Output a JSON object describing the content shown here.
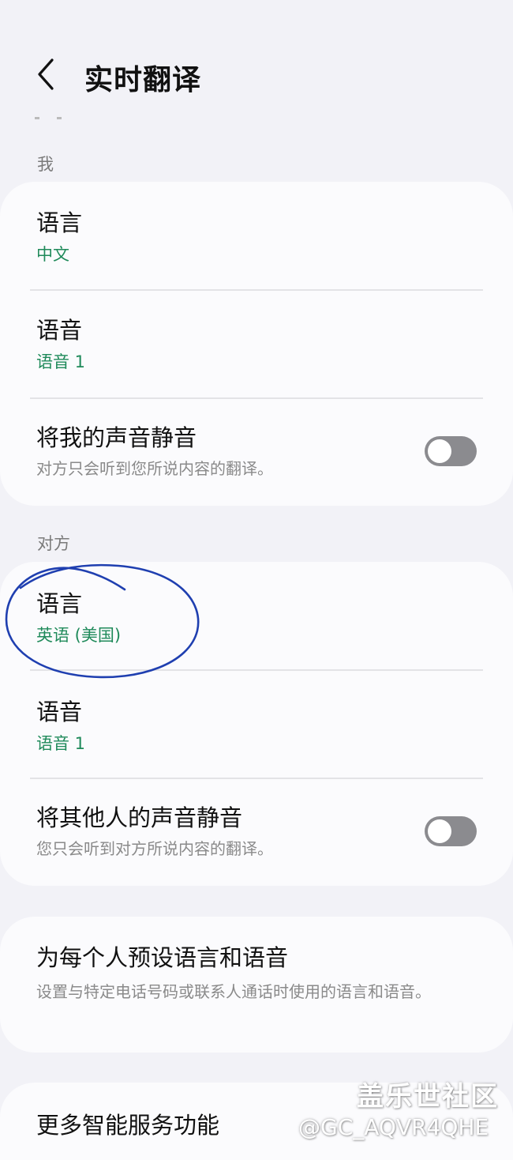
{
  "header": {
    "title": "实时翻译"
  },
  "me_section": {
    "label": "我",
    "language": {
      "title": "语言",
      "value": "中文"
    },
    "voice": {
      "title": "语音",
      "value": "语音 1"
    },
    "mute": {
      "title": "将我的声音静音",
      "description": "对方只会听到您所说内容的翻译。",
      "enabled": false
    }
  },
  "other_section": {
    "label": "对方",
    "language": {
      "title": "语言",
      "value": "英语 (美国)"
    },
    "voice": {
      "title": "语音",
      "value": "语音 1"
    },
    "mute": {
      "title": "将其他人的声音静音",
      "description": "您只会听到对方所说内容的翻译。",
      "enabled": false
    }
  },
  "preset": {
    "title": "为每个人预设语言和语音",
    "description": "设置与特定电话号码或联系人通话时使用的语言和语音。"
  },
  "more": {
    "title": "更多智能服务功能"
  },
  "watermark": {
    "site": "盖乐世社区",
    "handle": "@GC_AQVR4QHE"
  },
  "colors": {
    "background": "#f2f2f7",
    "card": "#fbfbfd",
    "accent_green": "#1f8a5a",
    "toggle_off": "#8b8b8f",
    "annotation_ink": "#1f3fb0"
  }
}
